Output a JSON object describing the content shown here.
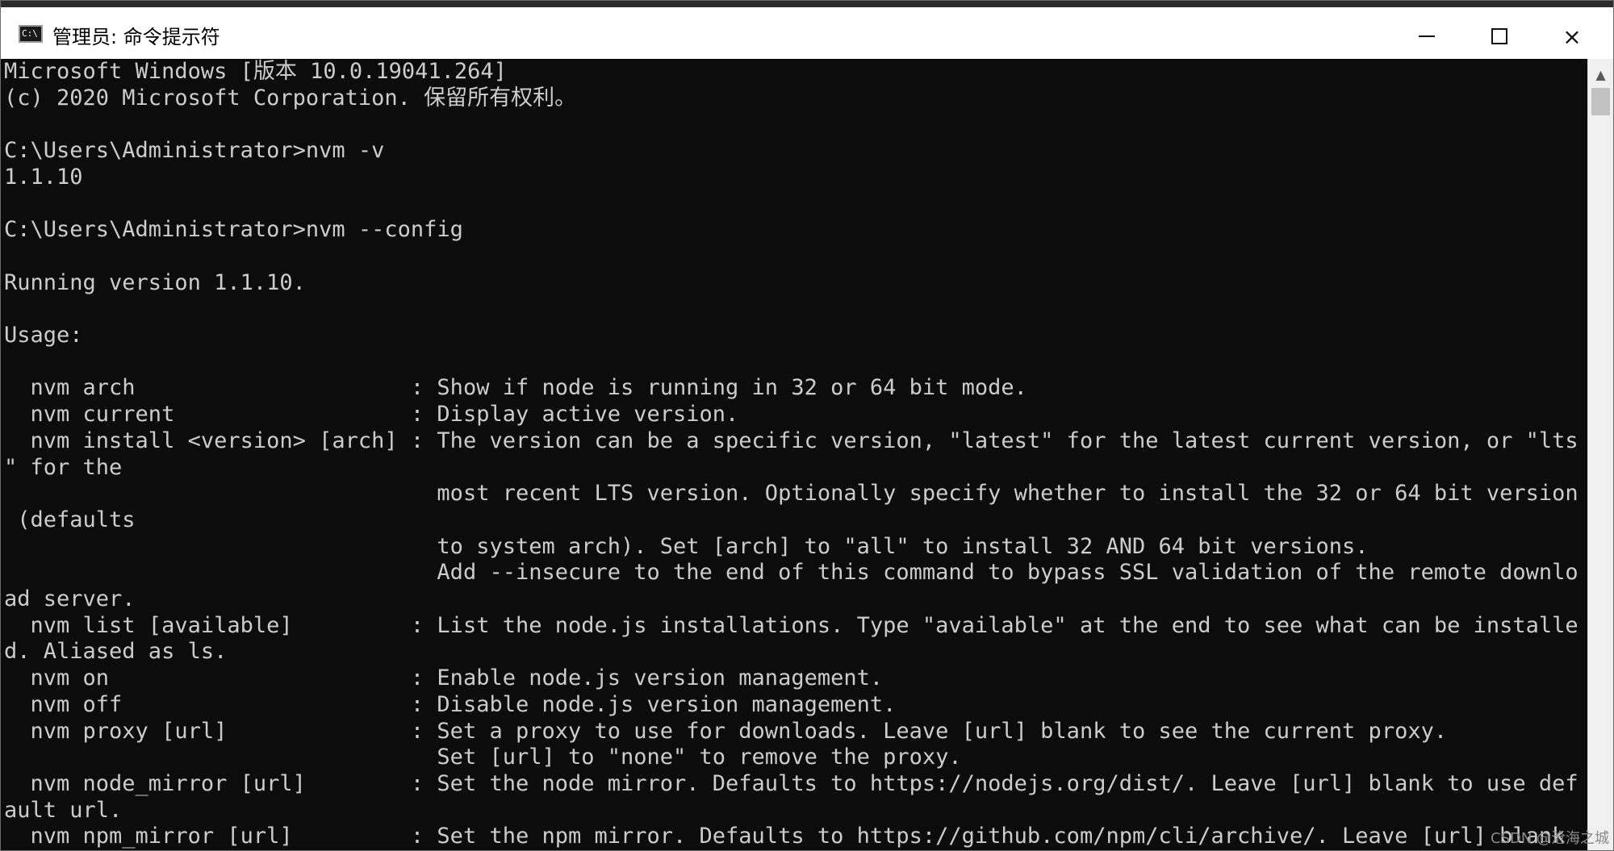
{
  "window": {
    "title": "管理员: 命令提示符",
    "icon_text": "C:\\",
    "icon": "console-icon",
    "controls": {
      "minimize": "minimize-icon",
      "maximize": "maximize-icon",
      "close": "×"
    }
  },
  "console": {
    "lines": [
      "Microsoft Windows [版本 10.0.19041.264]",
      "(c) 2020 Microsoft Corporation. 保留所有权利。",
      "",
      "C:\\Users\\Administrator>nvm -v",
      "1.1.10",
      "",
      "C:\\Users\\Administrator>nvm --config",
      "",
      "Running version 1.1.10.",
      "",
      "Usage:",
      "",
      "  nvm arch                     : Show if node is running in 32 or 64 bit mode.",
      "  nvm current                  : Display active version.",
      "  nvm install <version> [arch] : The version can be a specific version, \"latest\" for the latest current version, or \"lts",
      "\" for the",
      "                                 most recent LTS version. Optionally specify whether to install the 32 or 64 bit version",
      " (defaults",
      "                                 to system arch). Set [arch] to \"all\" to install 32 AND 64 bit versions.",
      "                                 Add --insecure to the end of this command to bypass SSL validation of the remote downlo",
      "ad server.",
      "  nvm list [available]         : List the node.js installations. Type \"available\" at the end to see what can be installe",
      "d. Aliased as ls.",
      "  nvm on                       : Enable node.js version management.",
      "  nvm off                      : Disable node.js version management.",
      "  nvm proxy [url]              : Set a proxy to use for downloads. Leave [url] blank to see the current proxy.",
      "                                 Set [url] to \"none\" to remove the proxy.",
      "  nvm node_mirror [url]        : Set the node mirror. Defaults to https://nodejs.org/dist/. Leave [url] blank to use def",
      "ault url.",
      "  nvm npm_mirror [url]         : Set the npm mirror. Defaults to https://github.com/npm/cli/archive/. Leave [url] blank"
    ]
  },
  "scrollbar": {
    "up_arrow": "▲"
  },
  "watermark": "CSDN @沧海之城",
  "colors": {
    "console_bg": "#0c0c0c",
    "console_fg": "#cccccc",
    "titlebar_bg": "#ffffff"
  }
}
